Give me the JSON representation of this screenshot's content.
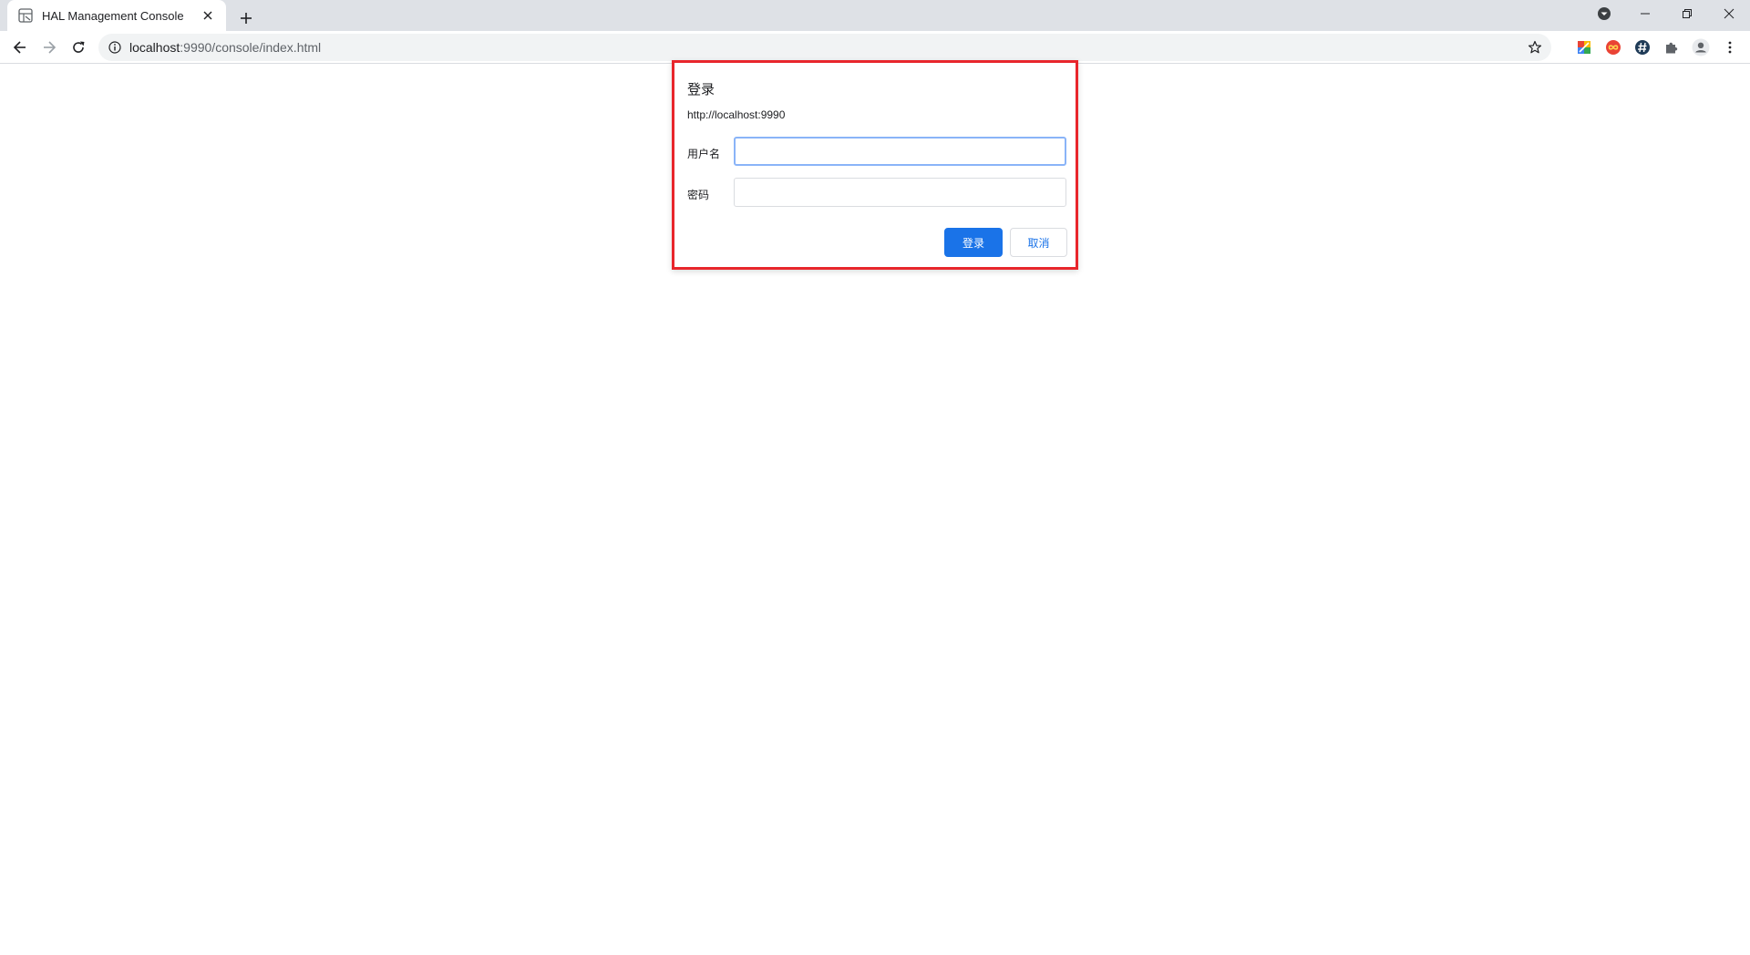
{
  "browser": {
    "tab": {
      "title": "HAL Management Console",
      "favicon": "hal-console-icon"
    },
    "new_tab_icon": "plus-icon",
    "window_controls": [
      "profile-dropdown-icon",
      "minimize-icon",
      "restore-icon",
      "close-icon"
    ],
    "omnibox": {
      "host": "localhost",
      "path": ":9990/console/index.html",
      "info_icon": "info-icon",
      "bookmark_icon": "star-icon"
    },
    "extensions": [
      "google-drive-icon",
      "infinity-icon",
      "hashtag-icon",
      "puzzle-icon",
      "profile-icon",
      "kebab-menu-icon"
    ]
  },
  "dialog": {
    "title": "登录",
    "origin": "http://localhost:9990",
    "username_label": "用户名",
    "username_value": "",
    "password_label": "密码",
    "password_value": "",
    "login_button": "登录",
    "cancel_button": "取消"
  },
  "colors": {
    "highlight_border": "#e8262c",
    "primary_button": "#1a73e8",
    "tabstrip_bg": "#dee1e6",
    "omnibox_bg": "#f1f3f4"
  }
}
